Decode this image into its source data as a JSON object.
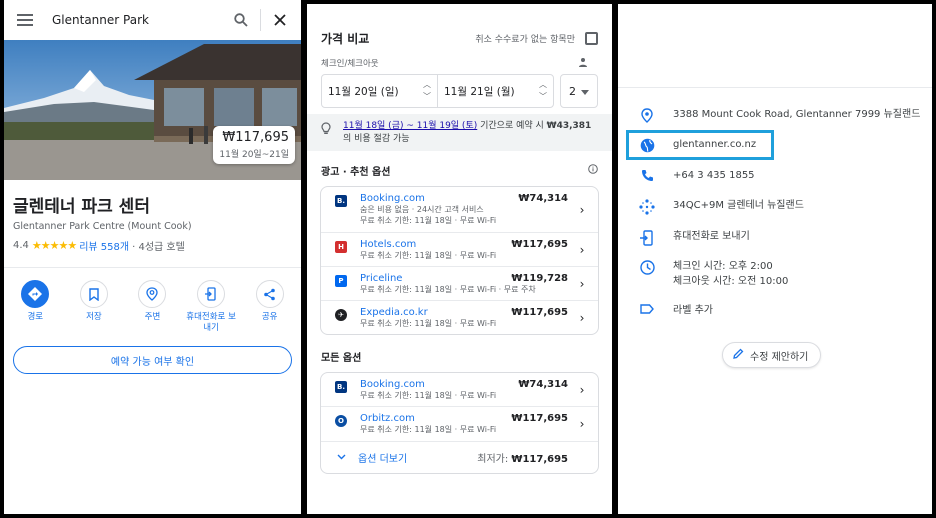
{
  "left": {
    "search_title": "Glentanner Park",
    "price_badge": {
      "price": "₩117,695",
      "dates": "11월 20일~21일"
    },
    "hotel_name": "글렌테너 파크 센터",
    "hotel_sub": "Glentanner Park Centre (Mount Cook)",
    "rating": {
      "score": "4.4",
      "stars": "★★★★★",
      "reviews": "리뷰 558개",
      "class": "· 4성급 호텔"
    },
    "actions": [
      {
        "label": "경로",
        "icon": "directions-icon"
      },
      {
        "label": "저장",
        "icon": "bookmark-icon"
      },
      {
        "label": "주변",
        "icon": "nearby-icon"
      },
      {
        "label": "휴대전화로 보내기",
        "icon": "send-to-phone-icon"
      },
      {
        "label": "공유",
        "icon": "share-icon"
      }
    ],
    "book_button": "예약 가능 여부 확인"
  },
  "middle": {
    "title": "가격 비교",
    "free_cancel_label": "취소 수수료가 없는 항목만",
    "checkin_label": "체크인/체크아웃",
    "checkin": "11월 20일 (일)",
    "checkout": "11월 21일 (월)",
    "guests": "2",
    "tip": {
      "dates": "11월 18일 (금) ~ 11월 19일 (토)",
      "text1": " 기간으로 예약 시 ",
      "amount": "₩43,381",
      "text2": "의 비용 절감 가능"
    },
    "ads_title": "광고 · 추천 옵션",
    "ads": [
      {
        "site": "Booking.com",
        "price": "₩74,314",
        "sub1": "숨은 비용 없음 · 24시간 고객 서비스",
        "sub2": "무료 취소 기한: 11월 18일 · 무료 Wi-Fi",
        "logo": "B.",
        "color": "#003580"
      },
      {
        "site": "Hotels.com",
        "price": "₩117,695",
        "sub1": "무료 취소 기한: 11월 18일 · 무료 Wi-Fi",
        "sub2": "",
        "logo": "H",
        "color": "#d32f2f"
      },
      {
        "site": "Priceline",
        "price": "₩119,728",
        "sub1": "무료 취소 기한: 11월 18일 · 무료 Wi-Fi · 무료 주차",
        "sub2": "",
        "logo": "P",
        "color": "#0068ef"
      },
      {
        "site": "Expedia.co.kr",
        "price": "₩117,695",
        "sub1": "무료 취소 기한: 11월 18일 · 무료 Wi-Fi",
        "sub2": "",
        "logo": "✈",
        "color": "#202124"
      }
    ],
    "all_title": "모든 옵션",
    "all": [
      {
        "site": "Booking.com",
        "price": "₩74,314",
        "sub1": "무료 취소 기한: 11월 18일 · 무료 Wi-Fi",
        "logo": "B.",
        "color": "#003580"
      },
      {
        "site": "Orbitz.com",
        "price": "₩117,695",
        "sub1": "무료 취소 기한: 11월 18일 · 무료 Wi-Fi",
        "logo": "O",
        "color": "#0a4ea3"
      }
    ],
    "more_label": "옵션 더보기",
    "lowest_label": "최저가: ",
    "lowest_price": "₩117,695"
  },
  "right": {
    "address": "3388 Mount Cook Road, Glentanner 7999 뉴질랜드",
    "website": "glentanner.co.nz",
    "phone": "+64 3 435 1855",
    "plus_code": "34QC+9M 글렌테너 뉴질랜드",
    "send_to_phone": "휴대전화로 보내기",
    "checkin_time": "체크인 시간: 오후 2:00",
    "checkout_time": "체크아웃 시간: 오전 10:00",
    "add_label": "라벨 추가",
    "suggest_edit": "수정 제안하기",
    "accent": "#1a73e8",
    "highlight_color": "#1fa0dc"
  }
}
